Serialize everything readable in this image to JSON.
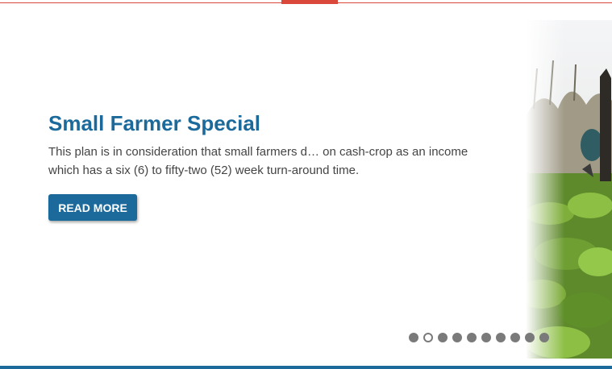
{
  "slide": {
    "title": "Small Farmer Special",
    "text": "This plan is in consideration that small farmers d… on cash-crop as an income which has a six (6) to fifty-two (52) week turn-around time.",
    "button_label": "READ MORE"
  },
  "pager": {
    "total": 10,
    "active_index": 1
  },
  "colors": {
    "accent": "#1b6a9b",
    "top_bar": "#d9483b",
    "dot": "#7a7a7a"
  }
}
